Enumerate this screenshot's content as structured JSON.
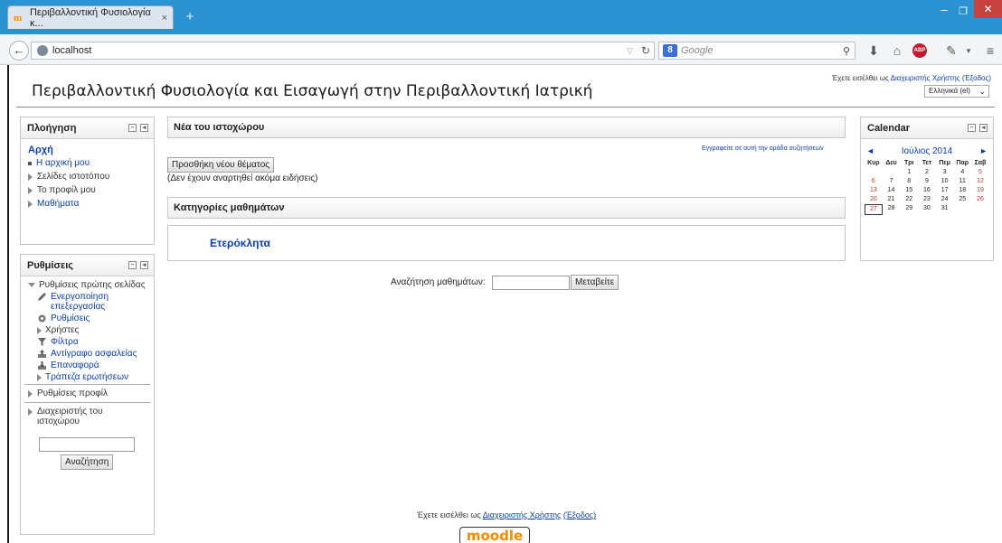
{
  "browser": {
    "tab_title": "Περιβαλλοντική Φυσιολογία κ...",
    "tab_favicon": "moodle-icon",
    "new_tab": "+",
    "url": "localhost",
    "search_placeholder": "Google",
    "search_engine_icon": "google-icon"
  },
  "header": {
    "site_title": "Περιβαλλοντική Φυσιολογία και Εισαγωγή στην Περιβαλλοντική Ιατρική",
    "login_prefix": "Έχετε εισέλθει ως",
    "login_user": "Διαχειριστής Χρήστης",
    "login_logout": "(Έξοδος)",
    "language": "Ελληνικά (el)"
  },
  "navigation": {
    "title": "Πλοήγηση",
    "home": "Αρχή",
    "items": [
      {
        "label": "Η αρχική μου",
        "icon": "bullet"
      },
      {
        "label": "Σελίδες ιστοτόπου",
        "icon": "expand"
      },
      {
        "label": "Το προφίλ μου",
        "icon": "expand"
      },
      {
        "label": "Μαθήματα",
        "icon": "expand"
      }
    ]
  },
  "settings": {
    "title": "Ρυθμίσεις",
    "frontpage_settings": "Ρυθμίσεις πρώτης σελίδας",
    "items": [
      {
        "label": "Ενεργοποίηση επεξεργασίας",
        "icon": "pencil-icon"
      },
      {
        "label": "Ρυθμίσεις",
        "icon": "gear-icon"
      },
      {
        "label": "Χρήστες",
        "icon": "expand"
      },
      {
        "label": "Φίλτρα",
        "icon": "filter-icon"
      },
      {
        "label": "Αντίγραφο ασφαλείας",
        "icon": "backup-icon"
      },
      {
        "label": "Επαναφορά",
        "icon": "restore-icon"
      },
      {
        "label": "Τράπεζα ερωτήσεων",
        "icon": "expand"
      }
    ],
    "profile_settings": "Ρυθμίσεις προφίλ",
    "site_admin": "Διαχειριστής του ιστοχώρου",
    "search_button": "Αναζήτηση"
  },
  "main": {
    "news_title": "Νέα του ιστοχώρου",
    "subscribe": "Εγγραφείτε σε αυτή την ομάδα συζητήσεων",
    "add_topic": "Προσθήκη νέου θέματος",
    "no_news": "(Δεν έχουν αναρτηθεί ακόμα ειδήσεις)",
    "categories_title": "Κατηγορίες μαθημάτων",
    "category": "Ετερόκλητα",
    "course_search_label": "Αναζήτηση μαθημάτων:",
    "go_button": "Μεταβείτε"
  },
  "calendar": {
    "title": "Calendar",
    "month": "Ιούλιος 2014",
    "prev": "◄",
    "next": "►",
    "weekdays": [
      "Κυρ",
      "Δευ",
      "Τρι",
      "Τετ",
      "Πεμ",
      "Παρ",
      "Σαβ"
    ],
    "weeks": [
      [
        "",
        "",
        "1",
        "2",
        "3",
        "4",
        "5"
      ],
      [
        "6",
        "7",
        "8",
        "9",
        "10",
        "11",
        "12"
      ],
      [
        "13",
        "14",
        "15",
        "16",
        "17",
        "18",
        "19"
      ],
      [
        "20",
        "21",
        "22",
        "23",
        "24",
        "25",
        "26"
      ],
      [
        "27",
        "28",
        "29",
        "30",
        "31",
        "",
        ""
      ]
    ],
    "today": "27"
  },
  "footer": {
    "login_prefix": "Έχετε εισέλθει ως",
    "login_user": "Διαχειριστής Χρήστης",
    "login_logout": "(Έξοδος)",
    "logo_text": "moodle"
  },
  "colors": {
    "titlebar": "#2c93d3",
    "link": "#0b3db5",
    "weekend": "#c0392b",
    "moodle_orange": "#f28c00"
  }
}
